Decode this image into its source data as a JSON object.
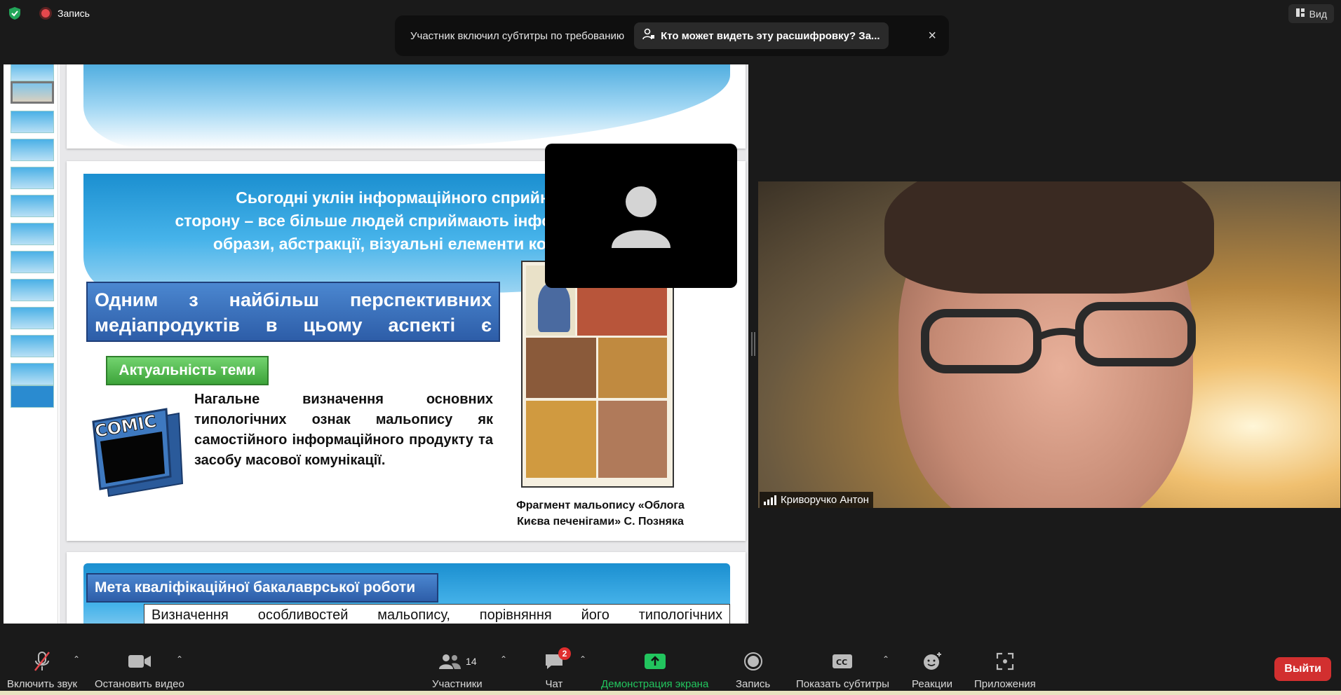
{
  "status": {
    "recording_label": "Запись",
    "view_label": "Вид"
  },
  "banner": {
    "text": "Участник включил субтитры по требованию",
    "pill": "Кто может видеть эту расшифровку? За...",
    "close": "×"
  },
  "slides": {
    "s2_headline_1": "Сьогодні уклін інформаційного сприйняття й",
    "s2_headline_2": "сторону – все більше людей сприймають інформацію через",
    "s2_headline_3": "образи, абстракції, візуальні елементи комунікації.",
    "blue_box_1": "Одним з найбільш перспективних",
    "blue_box_2": "медіапродуктів в цьому аспекті є мальопис",
    "green_box": "Актуальність теми",
    "body": "Нагальне визначення основних типологічних ознак мальопису як самостійного інформаційного продукту та засобу масової комунікації.",
    "comic_logo_text": "COMIC",
    "caption_1": "Фрагмент мальопису «Облога",
    "caption_2": "Києва печенігами» С. Позняка",
    "s3_box": "Мета кваліфікаційної бакалаврської роботи",
    "s3_text": "Визначення особливостей мальопису, порівняння його типологічних"
  },
  "video": {
    "participant_name": "Криворучко Антон"
  },
  "toolbar": {
    "mute": "Включить звук",
    "video": "Остановить видео",
    "participants": "Участники",
    "participants_count": "14",
    "chat": "Чат",
    "chat_badge": "2",
    "share": "Демонстрация экрана",
    "record": "Запись",
    "captions": "Показать субтитры",
    "reactions": "Реакции",
    "apps": "Приложения",
    "leave": "Выйти"
  },
  "colors": {
    "accent_green": "#22c55e",
    "leave_red": "#d22f2f",
    "slide_blue": "#2d5da8"
  }
}
